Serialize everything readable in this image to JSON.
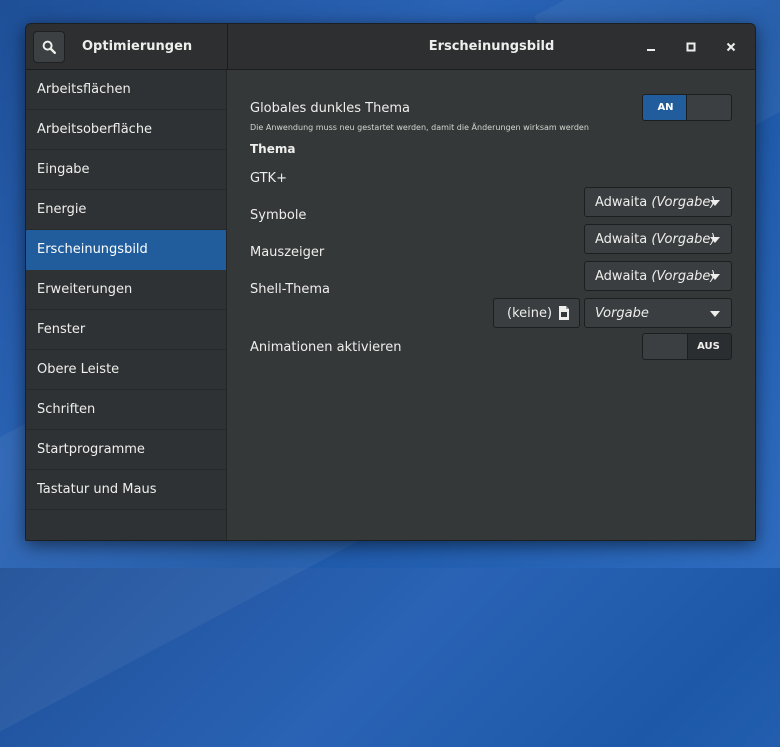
{
  "header": {
    "app_title": "Optimierungen",
    "page_title": "Erscheinungsbild",
    "icons": {
      "search": "search-icon",
      "minimize": "minimize-icon",
      "maximize": "maximize-icon",
      "close": "close-icon"
    }
  },
  "sidebar": {
    "items": [
      {
        "label": "Arbeitsflächen"
      },
      {
        "label": "Arbeitsoberfläche"
      },
      {
        "label": "Eingabe"
      },
      {
        "label": "Energie"
      },
      {
        "label": "Erscheinungsbild",
        "active": true
      },
      {
        "label": "Erweiterungen"
      },
      {
        "label": "Fenster"
      },
      {
        "label": "Obere Leiste"
      },
      {
        "label": "Schriften"
      },
      {
        "label": "Startprogramme"
      },
      {
        "label": "Tastatur und Maus"
      }
    ]
  },
  "main": {
    "dark_theme": {
      "label": "Globales dunkles Thema",
      "note": "Die Anwendung muss neu gestartet werden, damit die Änderungen wirksam werden",
      "switch_label": "AN",
      "on": true
    },
    "section_title": "Thema",
    "gtk": {
      "label": "GTK+",
      "value": "Adwaita",
      "value_suffix": "(Vorgabe)"
    },
    "icons": {
      "label": "Symbole",
      "value": "Adwaita",
      "value_suffix": "(Vorgabe)"
    },
    "cursor": {
      "label": "Mauszeiger",
      "value": "Adwaita",
      "value_suffix": "(Vorgabe)"
    },
    "shell": {
      "label": "Shell-Thema",
      "file_button": "(keine)",
      "value": "Vorgabe"
    },
    "animations": {
      "label": "Animationen aktivieren",
      "switch_label": "AUS",
      "on": false
    }
  },
  "colors": {
    "accent": "#215d9c",
    "window_bg": "#353839",
    "sidebar_bg": "#2f3234",
    "desktop": "#2a63b5"
  }
}
